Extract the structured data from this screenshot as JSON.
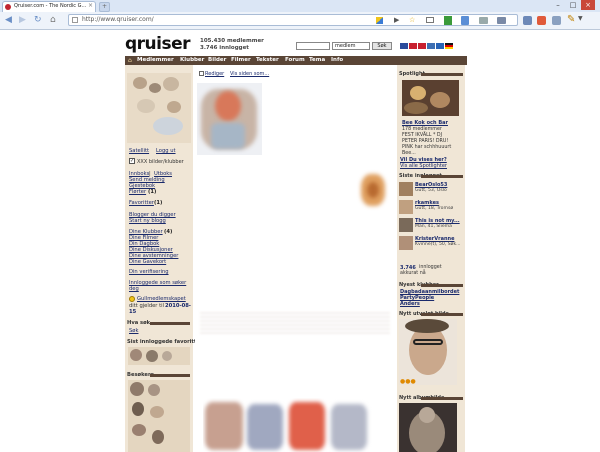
{
  "browser": {
    "tab_title": "Qruiser.com - The Nordic G...",
    "url": "http://www.qruiser.com/",
    "new_tab": "+",
    "window_buttons": [
      "–",
      "□",
      "×"
    ]
  },
  "header": {
    "logo_text": "qruiser",
    "members_count": "105.430 medlemmer",
    "logged_in_count": "3.746 innlogget",
    "search_placeholder": "",
    "search_select_value": "medlem",
    "search_button": "Søk"
  },
  "nav": {
    "items": [
      "Medlemmer",
      "Klubber",
      "Bilder",
      "Filmer",
      "Tekster",
      "Forum",
      "Tema",
      "Info"
    ]
  },
  "left": {
    "settings_link": "Satellitt",
    "logout_link": "Logg ut",
    "xxx_checkbox_label": "XXX bilder/klubber",
    "inbox_link": "Innboks",
    "outbox_link": "Utboks",
    "send_message_link": "Send melding",
    "guestbook_link": "Gjestebok",
    "flirts_link": "Flørter",
    "flirts_count": "(1)",
    "favorites_link": "Favoritter",
    "favorites_count": "(1)",
    "bloggers_link": "Blogger du digger",
    "start_blog_link": "Start ny blogg",
    "my_clubs_link": "Dine Klubber",
    "my_clubs_count": "(4)",
    "my_films_link": "Dine Filmer",
    "my_diary_link": "Din Dagbok",
    "my_discussions_link": "Dine Diskusjoner",
    "my_polls_link": "Dine avstemninger",
    "my_gifts_link": "Dine Gavekort",
    "verification_link": "Din verifisering",
    "logged_in_text_1": "Innloggede som søker",
    "logged_in_text_2": "deg",
    "gold_text_1": "Gullmedlemskapet",
    "gold_text_2": "ditt gjelder til",
    "gold_date_1": "2010-08-",
    "gold_date_2": "15",
    "search_heading": "Hva søk",
    "search_link": "Søk",
    "recent_fav_heading": "Sist innloggede favoritt",
    "visitors_heading": "Besøkere"
  },
  "center": {
    "edit_link": "Rediger",
    "view_link": "Vis siden som..."
  },
  "right": {
    "spotlight_heading": "Spotlight",
    "club_name": "Bee Kok och Bar",
    "club_members": "178 medlemmer",
    "club_desc_1": "FEST IKVÄLL * DJ",
    "club_desc_2": "PETER PARIS! DRU!",
    "club_desc_3": "PINK har schhhuuurt",
    "club_desc_4": "Bee...",
    "want_shown": "Vil Du vises her?",
    "spotlight_link": "Vis alle Spotlighter",
    "last_logged_heading": "Siste innlogget",
    "users": [
      {
        "name": "BearOslo53",
        "info": "Gutt, 53, Oslo"
      },
      {
        "name": "rkamkes",
        "info": "Gutt, 18, Tromsø"
      },
      {
        "name": "This is not my...",
        "info": "Man, 41, Sliema"
      },
      {
        "name": "KristerVranne",
        "info": "Kvinne(t), 50, Søk..."
      }
    ],
    "logged_count": "3.746",
    "logged_label": "innlogget",
    "logged_now": "akkurat nå",
    "newest_clubs_heading": "Nyest klubber",
    "clubs": [
      "Dagbadaanmilbordet",
      "PartyPeople",
      "Anders"
    ],
    "newest_profile_heading": "Nytt utvalgt bilde",
    "newest_album_heading": "Nytt albumbilde"
  },
  "colors": {
    "nav_bg": "#5a4536",
    "column_bg": "#f0e6d6",
    "logo_dot": "#d0142a",
    "link": "#1a2a6c"
  }
}
